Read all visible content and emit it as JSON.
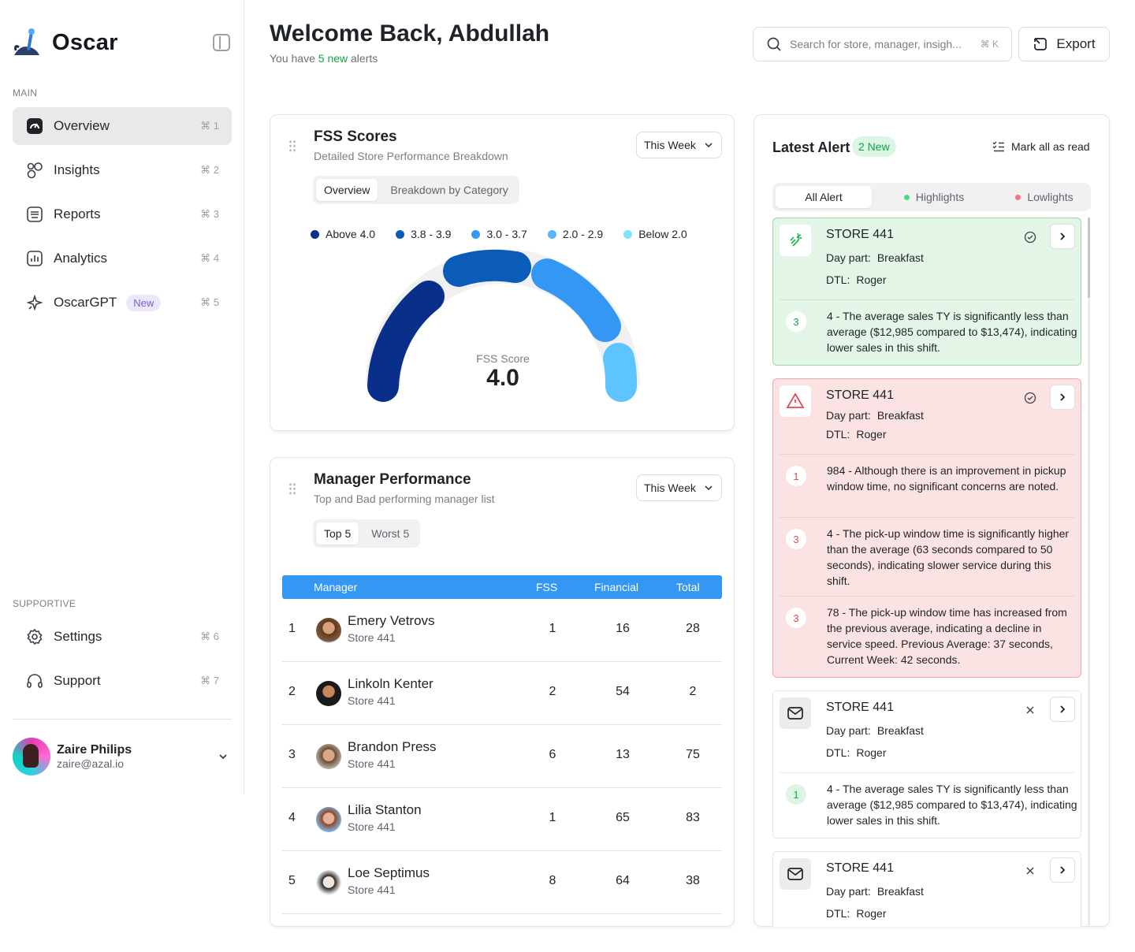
{
  "app": {
    "name": "Oscar"
  },
  "sidebar": {
    "main_label": "MAIN",
    "supportive_label": "SUPPORTIVE",
    "items": [
      {
        "label": "Overview",
        "shortcut": "⌘ 1",
        "icon": "gauge-icon"
      },
      {
        "label": "Insights",
        "shortcut": "⌘ 2",
        "icon": "circles-icon"
      },
      {
        "label": "Reports",
        "shortcut": "⌘ 3",
        "icon": "report-icon"
      },
      {
        "label": "Analytics",
        "shortcut": "⌘ 4",
        "icon": "bar-chart-icon"
      },
      {
        "label": "OscarGPT",
        "badge": "New",
        "shortcut": "⌘ 5",
        "icon": "sparkle-icon"
      }
    ],
    "support_items": [
      {
        "label": "Settings",
        "shortcut": "⌘ 6",
        "icon": "gear-icon"
      },
      {
        "label": "Support",
        "shortcut": "⌘ 7",
        "icon": "headphones-icon"
      }
    ],
    "user": {
      "name": "Zaire Philips",
      "email": "zaire@azal.io"
    }
  },
  "header": {
    "title": "Welcome Back, Abdullah",
    "subtitle_pre": "You have",
    "subtitle_highlight": "5 new",
    "subtitle_post": "alerts",
    "search_placeholder": "Search for store, manager, insigh...",
    "search_shortcut": "⌘ K",
    "export_label": "Export"
  },
  "fss": {
    "title": "FSS Scores",
    "subtitle": "Detailed Store Performance Breakdown",
    "period": "This Week",
    "tabs": [
      "Overview",
      "Breakdown by Category"
    ],
    "legend": [
      {
        "label": "Above 4.0",
        "color": "#0a2f8a"
      },
      {
        "label": "3.8 - 3.9",
        "color": "#0b5bb8"
      },
      {
        "label": "3.0 - 3.7",
        "color": "#3497f4"
      },
      {
        "label": "2.0 - 2.9",
        "color": "#5ab3fb"
      },
      {
        "label": "Below 2.0",
        "color": "#7fe4fb"
      }
    ],
    "score_label": "FSS Score",
    "score": "4.0"
  },
  "managers": {
    "title": "Manager Performance",
    "subtitle": "Top and Bad performing manager list",
    "period": "This Week",
    "tabs": [
      "Top 5",
      "Worst 5"
    ],
    "columns": [
      "Manager",
      "FSS",
      "Financial",
      "Total"
    ],
    "rows": [
      {
        "rank": "1",
        "name": "Emery Vetrovs",
        "store": "Store 441",
        "fss": "1",
        "financial": "16",
        "total": "28"
      },
      {
        "rank": "2",
        "name": "Linkoln Kenter",
        "store": "Store 441",
        "fss": "2",
        "financial": "54",
        "total": "2"
      },
      {
        "rank": "3",
        "name": "Brandon Press",
        "store": "Store 441",
        "fss": "6",
        "financial": "13",
        "total": "75"
      },
      {
        "rank": "4",
        "name": "Lilia Stanton",
        "store": "Store 441",
        "fss": "1",
        "financial": "65",
        "total": "83"
      },
      {
        "rank": "5",
        "name": "Loe Septimus",
        "store": "Store 441",
        "fss": "8",
        "financial": "64",
        "total": "38"
      }
    ]
  },
  "alerts": {
    "title": "Latest Alert",
    "new_badge": "2 New",
    "mark_all": "Mark all as read",
    "tabs": [
      "All Alert",
      "Highlights",
      "Lowlights"
    ],
    "day_part_label": "Day part:",
    "dtl_label": "DTL:",
    "cards": [
      {
        "store": "STORE 441",
        "day_part": "Breakfast",
        "dtl": "Roger",
        "items": [
          {
            "num": "3",
            "text": "4 - The average sales TY is significantly less than average ($12,985 compared to $13,474), indicating lower sales in this shift."
          }
        ]
      },
      {
        "store": "STORE 441",
        "day_part": "Breakfast",
        "dtl": "Roger",
        "items": [
          {
            "num": "1",
            "text": "984 - Although there is an improvement in pickup window time, no significant concerns are noted."
          },
          {
            "num": "3",
            "text": "4 - The pick-up window time is significantly higher than the average (63 seconds compared to 50 seconds), indicating slower service during this shift."
          },
          {
            "num": "3",
            "text": "78 - The pick-up window time has increased from the previous average, indicating a decline in service speed. Previous Average: 37 seconds, Current Week: 42 seconds."
          }
        ]
      },
      {
        "store": "STORE 441",
        "day_part": "Breakfast",
        "dtl": "Roger",
        "items": [
          {
            "num": "1",
            "text": "4 - The average sales TY is significantly less than average ($12,985 compared to $13,474), indicating lower sales in this shift."
          }
        ]
      },
      {
        "store": "STORE 441",
        "day_part": "Breakfast",
        "dtl": "Roger",
        "items": []
      }
    ]
  }
}
